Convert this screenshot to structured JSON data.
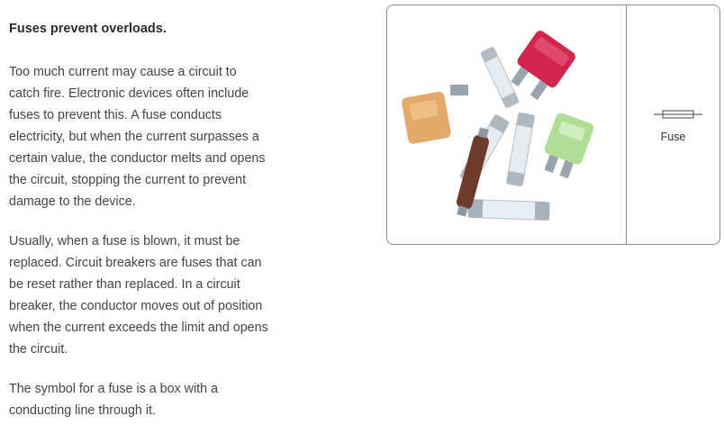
{
  "article": {
    "heading": "Fuses prevent overloads.",
    "paragraphs": [
      "Too much current may cause a circuit to catch fire. Electronic devices often include fuses to prevent this. A fuse conducts electricity, but when the current surpasses a certain value, the conductor melts and opens the circuit, stopping the current to prevent damage to the device.",
      "Usually, when a fuse is blown, it must be replaced. Circuit breakers are fuses that can be reset rather than replaced. In a circuit breaker, the conductor moves out of position when the current exceeds the limit and opens the circuit.",
      "The symbol for a fuse is a box with a conducting line through it."
    ]
  },
  "figure": {
    "symbol_label": "Fuse",
    "colors": {
      "blade_fuse_red": "#d0254c",
      "blade_fuse_orange": "#e0a05a",
      "blade_fuse_green": "#a6d98a",
      "ceramic_fuse": "#6e3b2a"
    }
  }
}
